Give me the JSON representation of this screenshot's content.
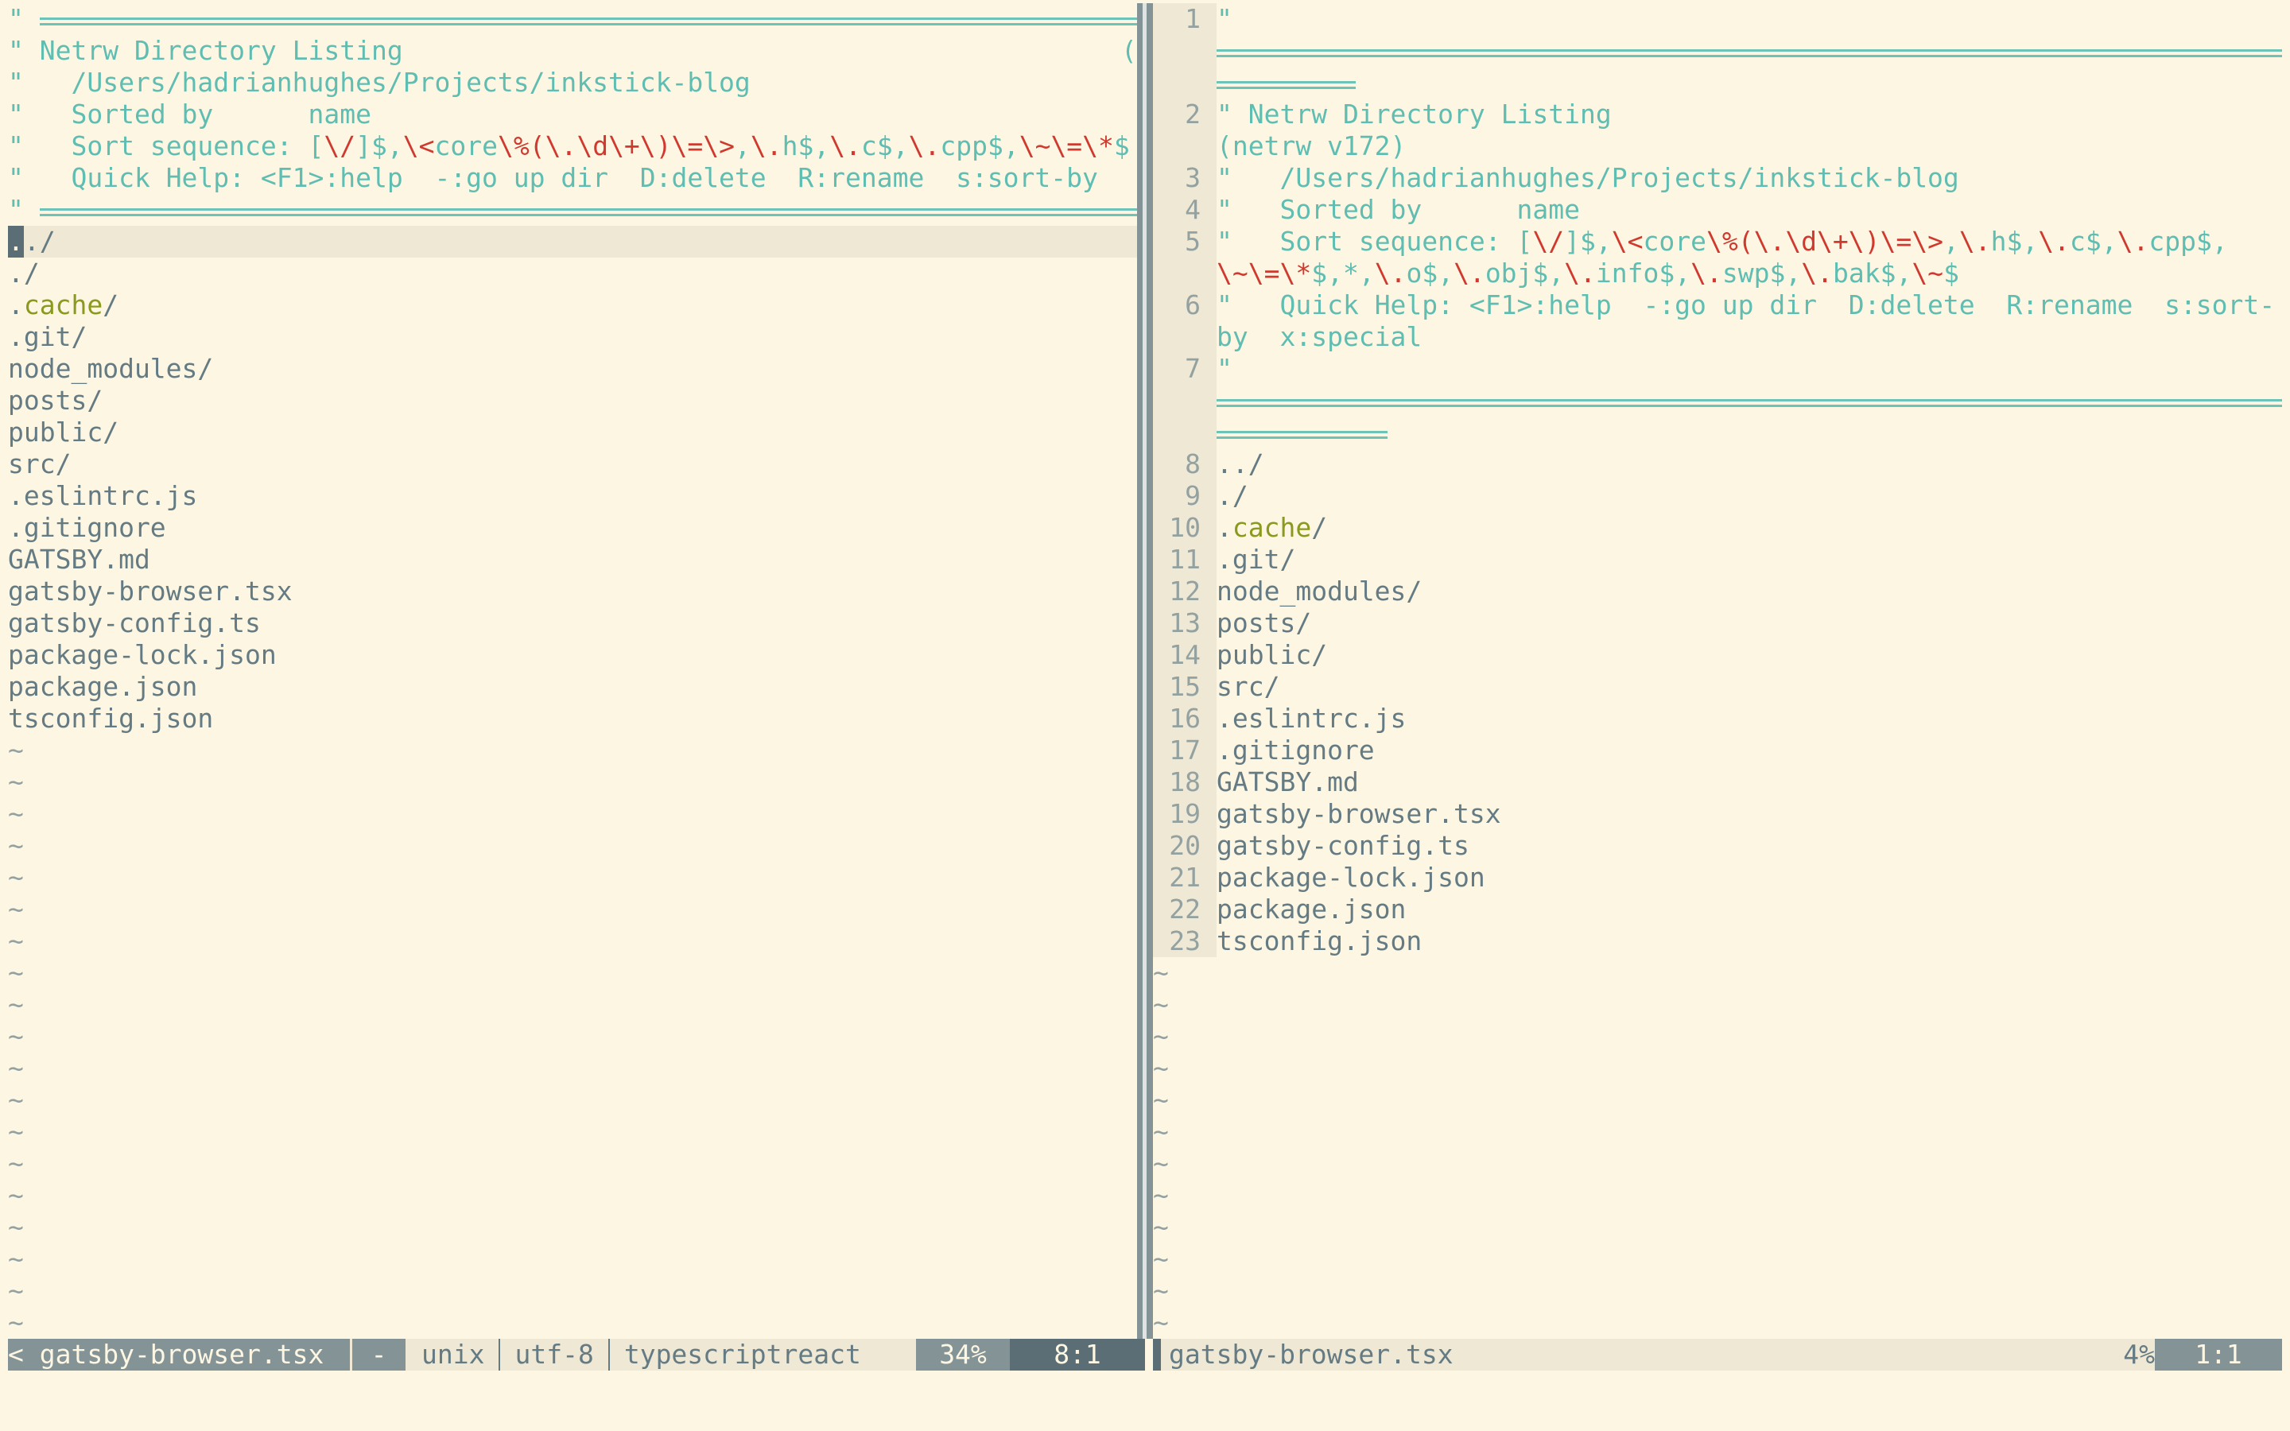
{
  "app": "Vim (netrw)",
  "colors": {
    "background": "#fdf6e3",
    "cursorline": "#eee8d5",
    "comment": "#5fbdb1",
    "special": "#d0392e",
    "directory_hidden": "#8a9a1e",
    "text": "#657b83",
    "status_mid": "#849396",
    "status_dark": "#5b6e75"
  },
  "left_pane": {
    "header": {
      "title": "Netrw Directory Listing",
      "version_truncated": "(netrw",
      "path": "/Users/hadrianhughes/Projects/inkstick-blog",
      "sorted_by_label": "Sorted by",
      "sorted_by_value": "name",
      "sort_sequence_label": "Sort sequence:",
      "sort_sequence_truncated": [
        {
          "t": "[",
          "c": "c"
        },
        {
          "t": "\\/",
          "c": "r"
        },
        {
          "t": "]$,",
          "c": "c"
        },
        {
          "t": "\\<",
          "c": "r"
        },
        {
          "t": "core",
          "c": "c"
        },
        {
          "t": "\\%(\\.",
          "c": "r"
        },
        {
          "t": "\\d\\+\\)\\=\\>",
          "c": "r"
        },
        {
          "t": ",",
          "c": "c"
        },
        {
          "t": "\\.",
          "c": "r"
        },
        {
          "t": "h$,",
          "c": "c"
        },
        {
          "t": "\\.",
          "c": "r"
        },
        {
          "t": "c$,",
          "c": "c"
        },
        {
          "t": "\\.",
          "c": "r"
        },
        {
          "t": "cpp$,",
          "c": "c"
        },
        {
          "t": "\\~\\=\\*",
          "c": "r"
        },
        {
          "t": "$",
          "c": "c"
        }
      ],
      "quick_help": "Quick Help: <F1>:help  -:go up dir  D:delete  R:rename  s:sort-by"
    },
    "cursor_char": ".",
    "entries": [
      {
        "name": "../"
      },
      {
        "name": "./"
      },
      {
        "name": ".cache/",
        "hidden_dir": true
      },
      {
        "name": ".git/"
      },
      {
        "name": "node_modules/"
      },
      {
        "name": "posts/"
      },
      {
        "name": "public/"
      },
      {
        "name": "src/"
      },
      {
        "name": ".eslintrc.js"
      },
      {
        "name": ".gitignore"
      },
      {
        "name": "GATSBY.md"
      },
      {
        "name": "gatsby-browser.tsx"
      },
      {
        "name": "gatsby-config.ts"
      },
      {
        "name": "package-lock.json"
      },
      {
        "name": "package.json"
      },
      {
        "name": "tsconfig.json"
      }
    ],
    "filler": "~",
    "statusline": {
      "filename": "< gatsby-browser.tsx",
      "modified": "-",
      "fileformat": "unix",
      "encoding": "utf-8",
      "filetype": "typescriptreact",
      "percent": "34%",
      "position": "8:1"
    }
  },
  "right_pane": {
    "header": {
      "line_numbers": [
        "1",
        "2",
        "3",
        "4",
        "5",
        "6",
        "7"
      ],
      "title": "Netrw Directory Listing",
      "version": "(netrw v172)",
      "path": "/Users/hadrianhughes/Projects/inkstick-blog",
      "sorted_by_label": "Sorted by",
      "sorted_by_value": "name",
      "sort_sequence_row1": [
        {
          "t": "Sort sequence: ",
          "c": "c"
        },
        {
          "t": "[",
          "c": "c"
        },
        {
          "t": "\\/",
          "c": "r"
        },
        {
          "t": "]$,",
          "c": "c"
        },
        {
          "t": "\\<",
          "c": "r"
        },
        {
          "t": "core",
          "c": "c"
        },
        {
          "t": "\\%(\\.",
          "c": "r"
        },
        {
          "t": "\\d\\+\\)\\=\\>",
          "c": "r"
        },
        {
          "t": ",",
          "c": "c"
        },
        {
          "t": "\\.",
          "c": "r"
        },
        {
          "t": "h$,",
          "c": "c"
        },
        {
          "t": "\\.",
          "c": "r"
        },
        {
          "t": "c$,",
          "c": "c"
        },
        {
          "t": "\\.",
          "c": "r"
        },
        {
          "t": "cpp$,",
          "c": "c"
        }
      ],
      "sort_sequence_row2": [
        {
          "t": "\\~\\=\\*",
          "c": "r"
        },
        {
          "t": "$,*,",
          "c": "c"
        },
        {
          "t": "\\.",
          "c": "r"
        },
        {
          "t": "o$,",
          "c": "c"
        },
        {
          "t": "\\.",
          "c": "r"
        },
        {
          "t": "obj$,",
          "c": "c"
        },
        {
          "t": "\\.",
          "c": "r"
        },
        {
          "t": "info$,",
          "c": "c"
        },
        {
          "t": "\\.",
          "c": "r"
        },
        {
          "t": "swp$,",
          "c": "c"
        },
        {
          "t": "\\.",
          "c": "r"
        },
        {
          "t": "bak$,",
          "c": "c"
        },
        {
          "t": "\\~",
          "c": "r"
        },
        {
          "t": "$",
          "c": "c"
        }
      ],
      "quick_help_row1": "Quick Help: <F1>:help  -:go up dir  D:delete  R:rename  s:sort-",
      "quick_help_row2": "by  x:special"
    },
    "entries": [
      {
        "num": "8",
        "name": "../"
      },
      {
        "num": "9",
        "name": "./"
      },
      {
        "num": "10",
        "name": ".cache/",
        "hidden_dir": true
      },
      {
        "num": "11",
        "name": ".git/"
      },
      {
        "num": "12",
        "name": "node_modules/"
      },
      {
        "num": "13",
        "name": "posts/"
      },
      {
        "num": "14",
        "name": "public/"
      },
      {
        "num": "15",
        "name": "src/"
      },
      {
        "num": "16",
        "name": ".eslintrc.js"
      },
      {
        "num": "17",
        "name": ".gitignore"
      },
      {
        "num": "18",
        "name": "GATSBY.md"
      },
      {
        "num": "19",
        "name": "gatsby-browser.tsx"
      },
      {
        "num": "20",
        "name": "gatsby-config.ts"
      },
      {
        "num": "21",
        "name": "package-lock.json"
      },
      {
        "num": "22",
        "name": "package.json"
      },
      {
        "num": "23",
        "name": "tsconfig.json"
      }
    ],
    "filler": "~",
    "statusline": {
      "filename": "gatsby-browser.tsx",
      "percent": "4%",
      "position": "1:1"
    }
  }
}
